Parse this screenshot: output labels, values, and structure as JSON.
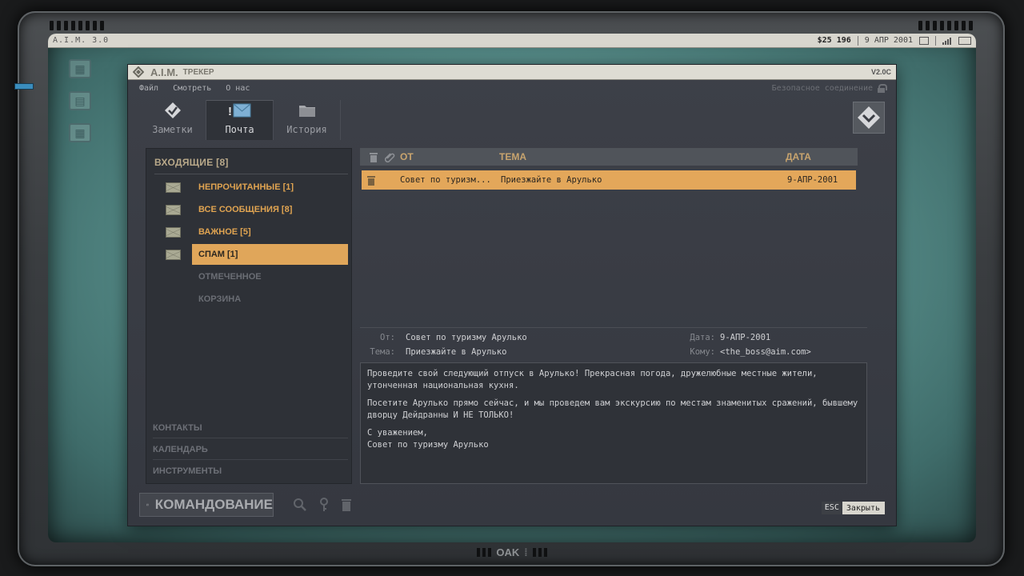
{
  "os": {
    "name": "A.I.M. 3.0",
    "money": "$25 196",
    "date": "9 АПР 2001"
  },
  "window": {
    "title": "A.I.M.",
    "subtitle": "ТРЕКЕР",
    "version": "V2.0C"
  },
  "menu": {
    "items": [
      "Файл",
      "Смотреть",
      "О нас"
    ],
    "secure": "Безопасное соединение"
  },
  "tabs": [
    {
      "label": "Заметки",
      "icon": "diamond-logo-icon"
    },
    {
      "label": "Почта",
      "icon": "mail-alert-icon"
    },
    {
      "label": "История",
      "icon": "folder-icon"
    }
  ],
  "sidebar": {
    "inbox": "ВХОДЯЩИЕ [8]",
    "folders": [
      {
        "label": "НЕПРОЧИТАННЫЕ [1]"
      },
      {
        "label": "ВСЕ СООБЩЕНИЯ [8]"
      },
      {
        "label": "ВАЖНОЕ [5]"
      },
      {
        "label": "СПАМ [1]"
      },
      {
        "label": "ОТМЕЧЕННОЕ"
      },
      {
        "label": "КОРЗИНА"
      }
    ],
    "sections": [
      "КОНТАКТЫ",
      "КАЛЕНДАРЬ",
      "ИНСТРУМЕНТЫ"
    ]
  },
  "list": {
    "columns": {
      "from": "ОТ",
      "subject": "ТЕМА",
      "date": "ДАТА"
    },
    "rows": [
      {
        "from": "Совет по туризм...",
        "subject": "Приезжайте в Арулько",
        "date": "9-АПР-2001"
      }
    ]
  },
  "message": {
    "from_label": "От:",
    "from": "Совет по туризму Арулько",
    "subject_label": "Тема:",
    "subject": "Приезжайте в Арулько",
    "date_label": "Дата:",
    "date": "9-АПР-2001",
    "to_label": "Кому:",
    "to": "<the_boss@aim.com>",
    "body": [
      "Проведите свой следующий отпуск в Арулько! Прекрасная погода, дружелюбные местные жители, утонченная национальная кухня.",
      "Посетите Арулько прямо сейчас, и мы проведем вам экскурсию по местам знаменитых сражений, бывшему дворцу Дейдранны И НЕ ТОЛЬКО!",
      "С уважением,",
      "Совет по туризму Арулько"
    ]
  },
  "bottom": {
    "command": "КОМАНДОВАНИЕ",
    "esc_key": "ESC",
    "close": "Закрыть"
  },
  "brand": "OAK"
}
